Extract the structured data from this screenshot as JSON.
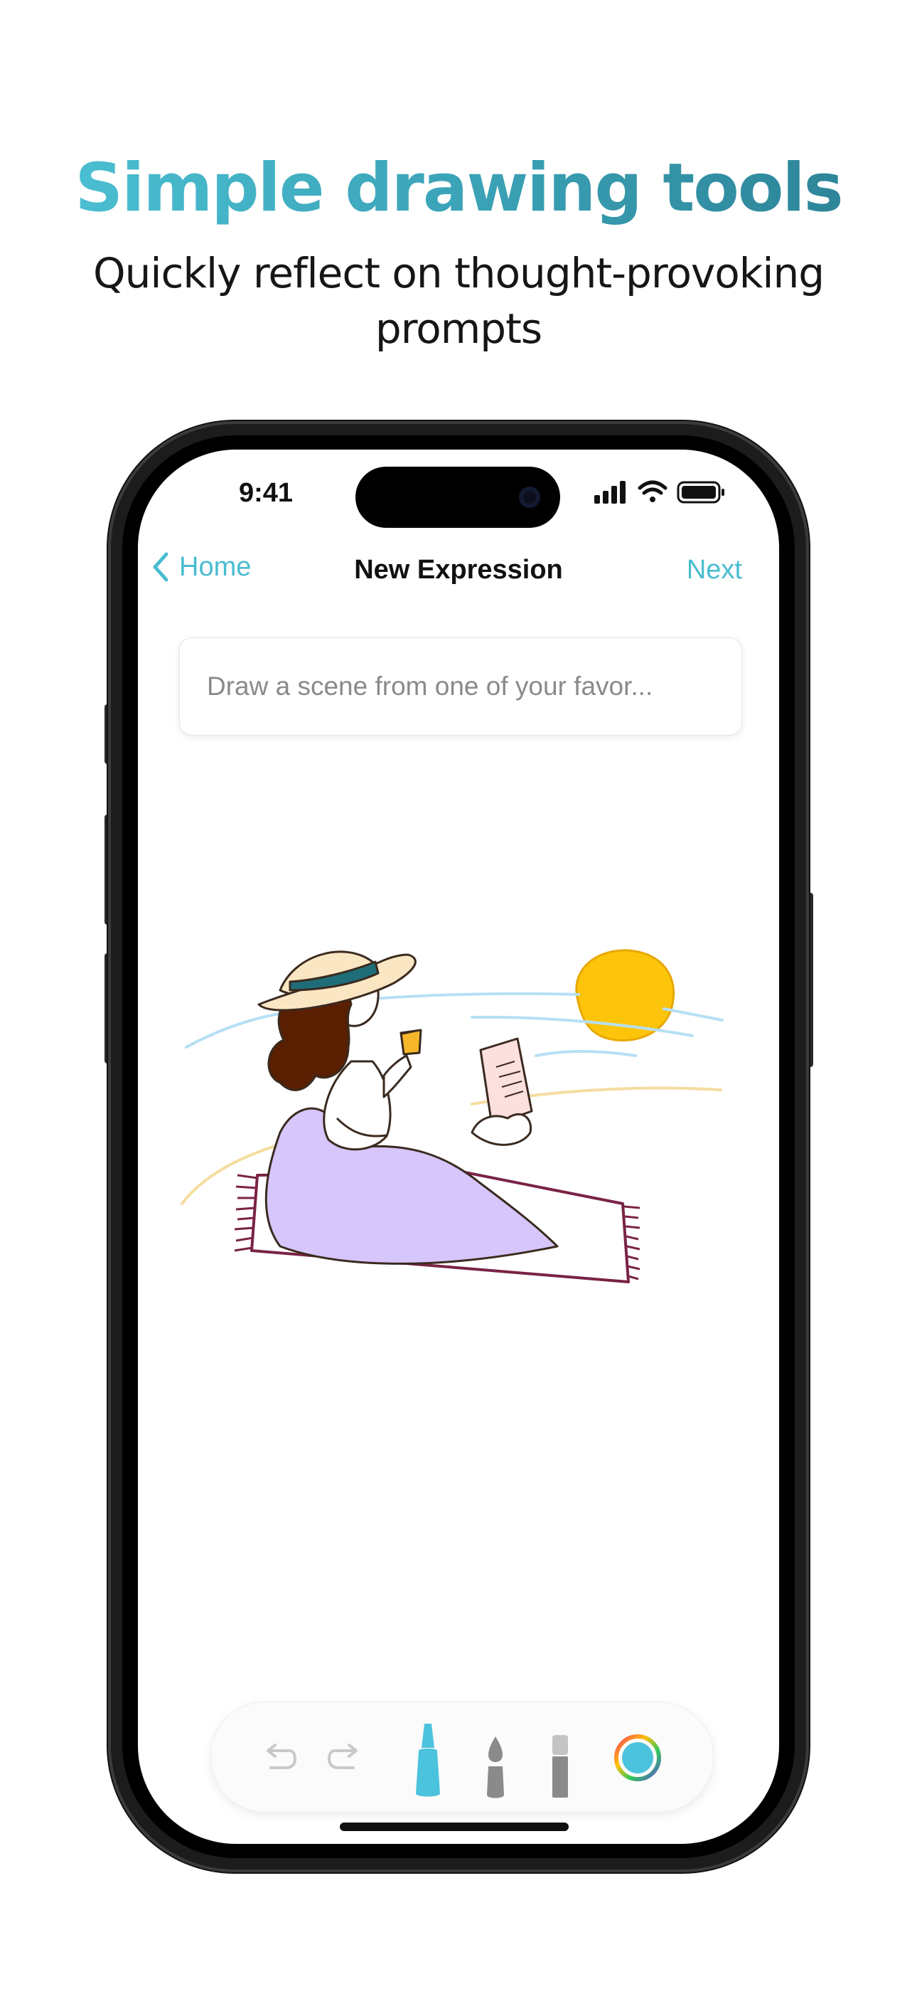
{
  "marketing": {
    "headline": "Simple drawing tools",
    "subheadline": "Quickly reflect on thought-provoking prompts"
  },
  "status_bar": {
    "time": "9:41"
  },
  "nav": {
    "back_label": "Home",
    "title": "New Expression",
    "next_label": "Next"
  },
  "prompt": {
    "text": "Draw a scene from one of your favor..."
  },
  "toolbar": {
    "tools": [
      "undo-icon",
      "redo-icon",
      "marker-icon",
      "brush-icon",
      "eraser-icon",
      "color-picker-icon"
    ],
    "selected_tool": "marker",
    "selected_color": "#4cc3dc"
  },
  "colors": {
    "accent": "#49bcd0",
    "headline_gradient": [
      "#4dc3d6",
      "#2b7f93"
    ]
  },
  "drawing": {
    "subject": "woman-reading-on-beach-illustration"
  }
}
